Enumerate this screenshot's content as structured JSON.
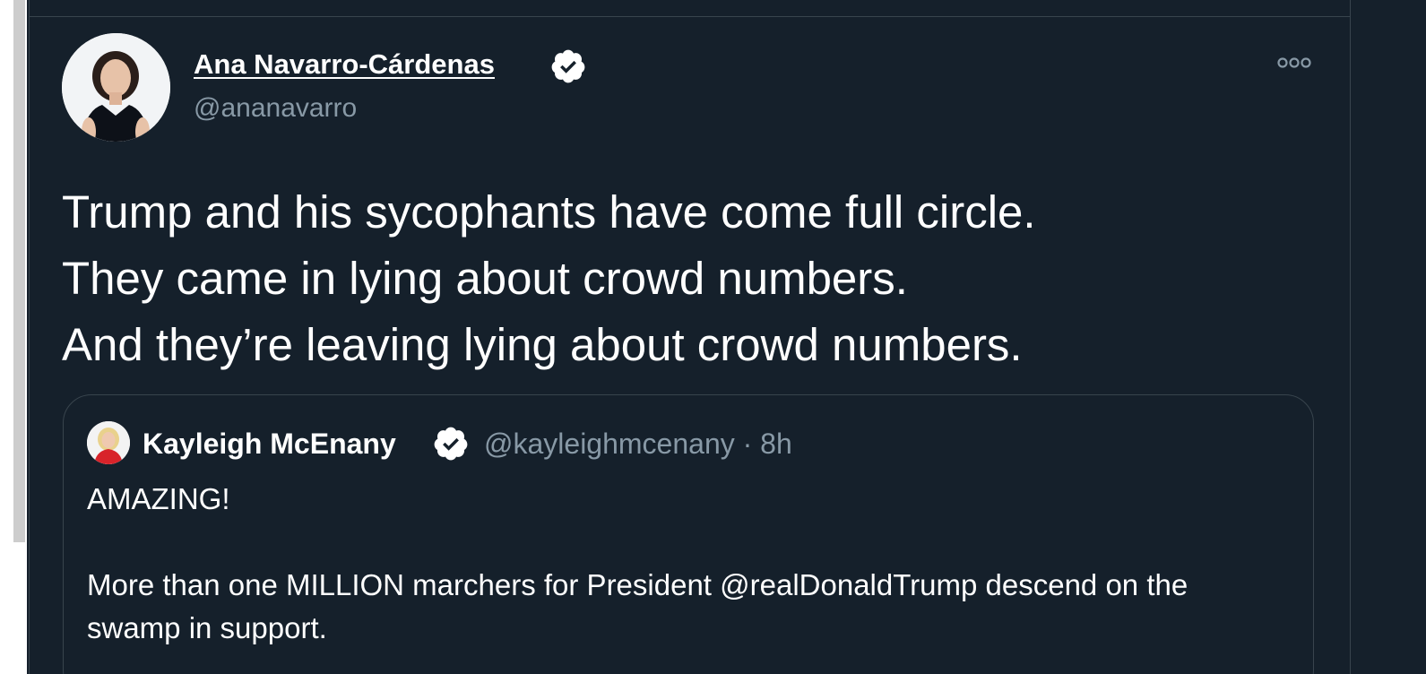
{
  "tweet": {
    "author_name": "Ana Navarro-Cárdenas",
    "author_handle": "@ananavarro",
    "avatar_icon": "profile-photo",
    "verified_icon": "verified-badge-icon",
    "more_icon": "more-options-icon",
    "text_lines": [
      "Trump and his sycophants have come full circle.",
      "They came in lying about crowd numbers.",
      "And they’re leaving lying about crowd numbers."
    ]
  },
  "quoted_tweet": {
    "author_name": "Kayleigh McEnany",
    "handle_and_time": "@kayleighmcenany · 8h",
    "paragraphs": [
      "AMAZING!",
      "More than one MILLION marchers for President @realDonaldTrump descend on the swamp in support."
    ]
  },
  "colors": {
    "background": "#15202b",
    "border": "#38444d",
    "secondary_text": "#8899a6",
    "primary_text": "#ffffff"
  }
}
